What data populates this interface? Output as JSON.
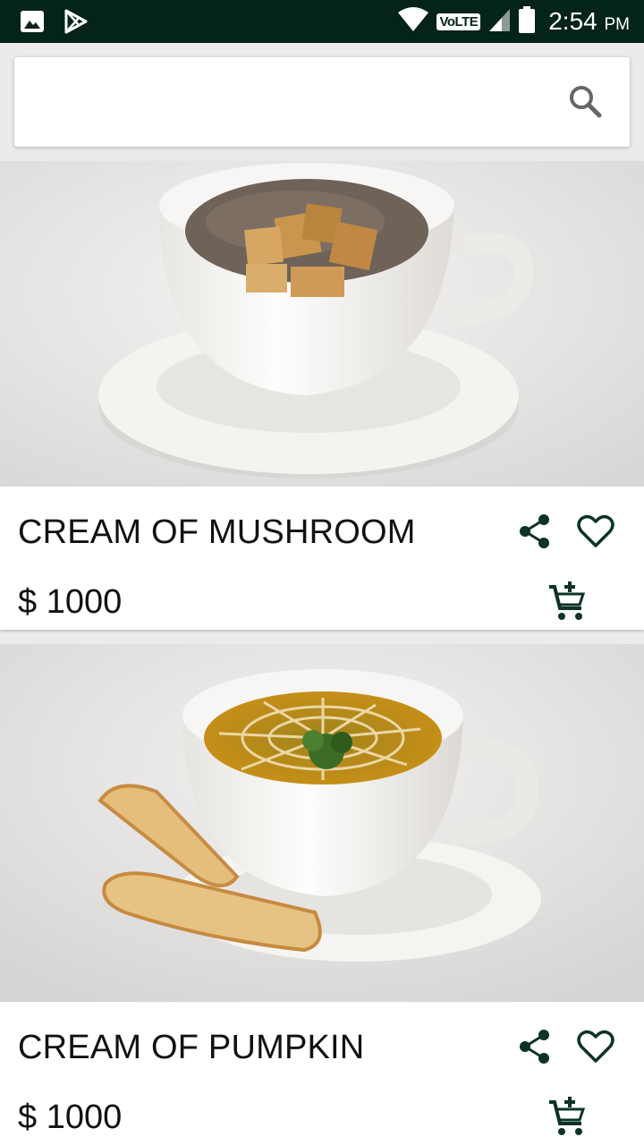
{
  "status_bar": {
    "network_label": "VoLTE",
    "time": "2:54",
    "ampm": "PM",
    "icons": [
      "gallery-icon",
      "play-store-icon",
      "wifi-icon",
      "signal-icon",
      "battery-icon"
    ]
  },
  "search": {
    "value": "",
    "placeholder": "",
    "icon": "search-icon"
  },
  "products": [
    {
      "title": "CREAM OF MUSHROOM",
      "price": "$ 1000",
      "image": "mushroom-soup-photo"
    },
    {
      "title": "CREAM OF PUMPKIN",
      "price": "$ 1000",
      "image": "pumpkin-soup-photo"
    }
  ],
  "colors": {
    "status_bar_bg": "#04231b",
    "icon_color": "#0c3326",
    "text": "#111111"
  }
}
